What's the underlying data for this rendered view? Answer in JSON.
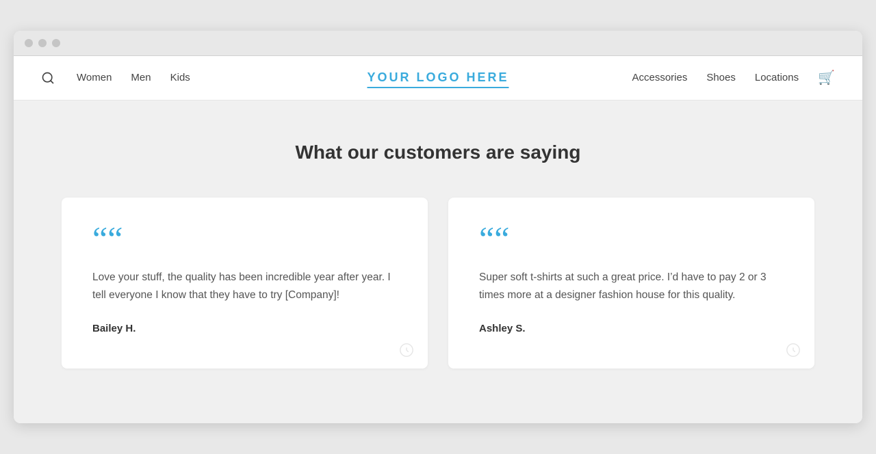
{
  "browser": {
    "dots": [
      "dot1",
      "dot2",
      "dot3"
    ]
  },
  "navbar": {
    "search_icon": "🔍",
    "logo": "YOUR LOGO HERE",
    "nav_left": [
      {
        "label": "Women",
        "id": "women"
      },
      {
        "label": "Men",
        "id": "men"
      },
      {
        "label": "Kids",
        "id": "kids"
      }
    ],
    "nav_right": [
      {
        "label": "Accessories",
        "id": "accessories"
      },
      {
        "label": "Shoes",
        "id": "shoes"
      },
      {
        "label": "Locations",
        "id": "locations"
      }
    ],
    "cart_icon": "🛒"
  },
  "main": {
    "section_title": "What our customers are saying",
    "testimonials": [
      {
        "id": "testimonial-1",
        "quote_mark": "““",
        "text": "Love your stuff, the quality has been incredible year after year. I tell everyone I know that they have to try [Company]!",
        "author": "Bailey H."
      },
      {
        "id": "testimonial-2",
        "quote_mark": "““",
        "text": "Super soft t-shirts at such a great price. I’d have to pay 2 or 3 times more at a designer fashion house for this quality.",
        "author": "Ashley S."
      }
    ]
  },
  "colors": {
    "accent": "#3aabdd"
  }
}
